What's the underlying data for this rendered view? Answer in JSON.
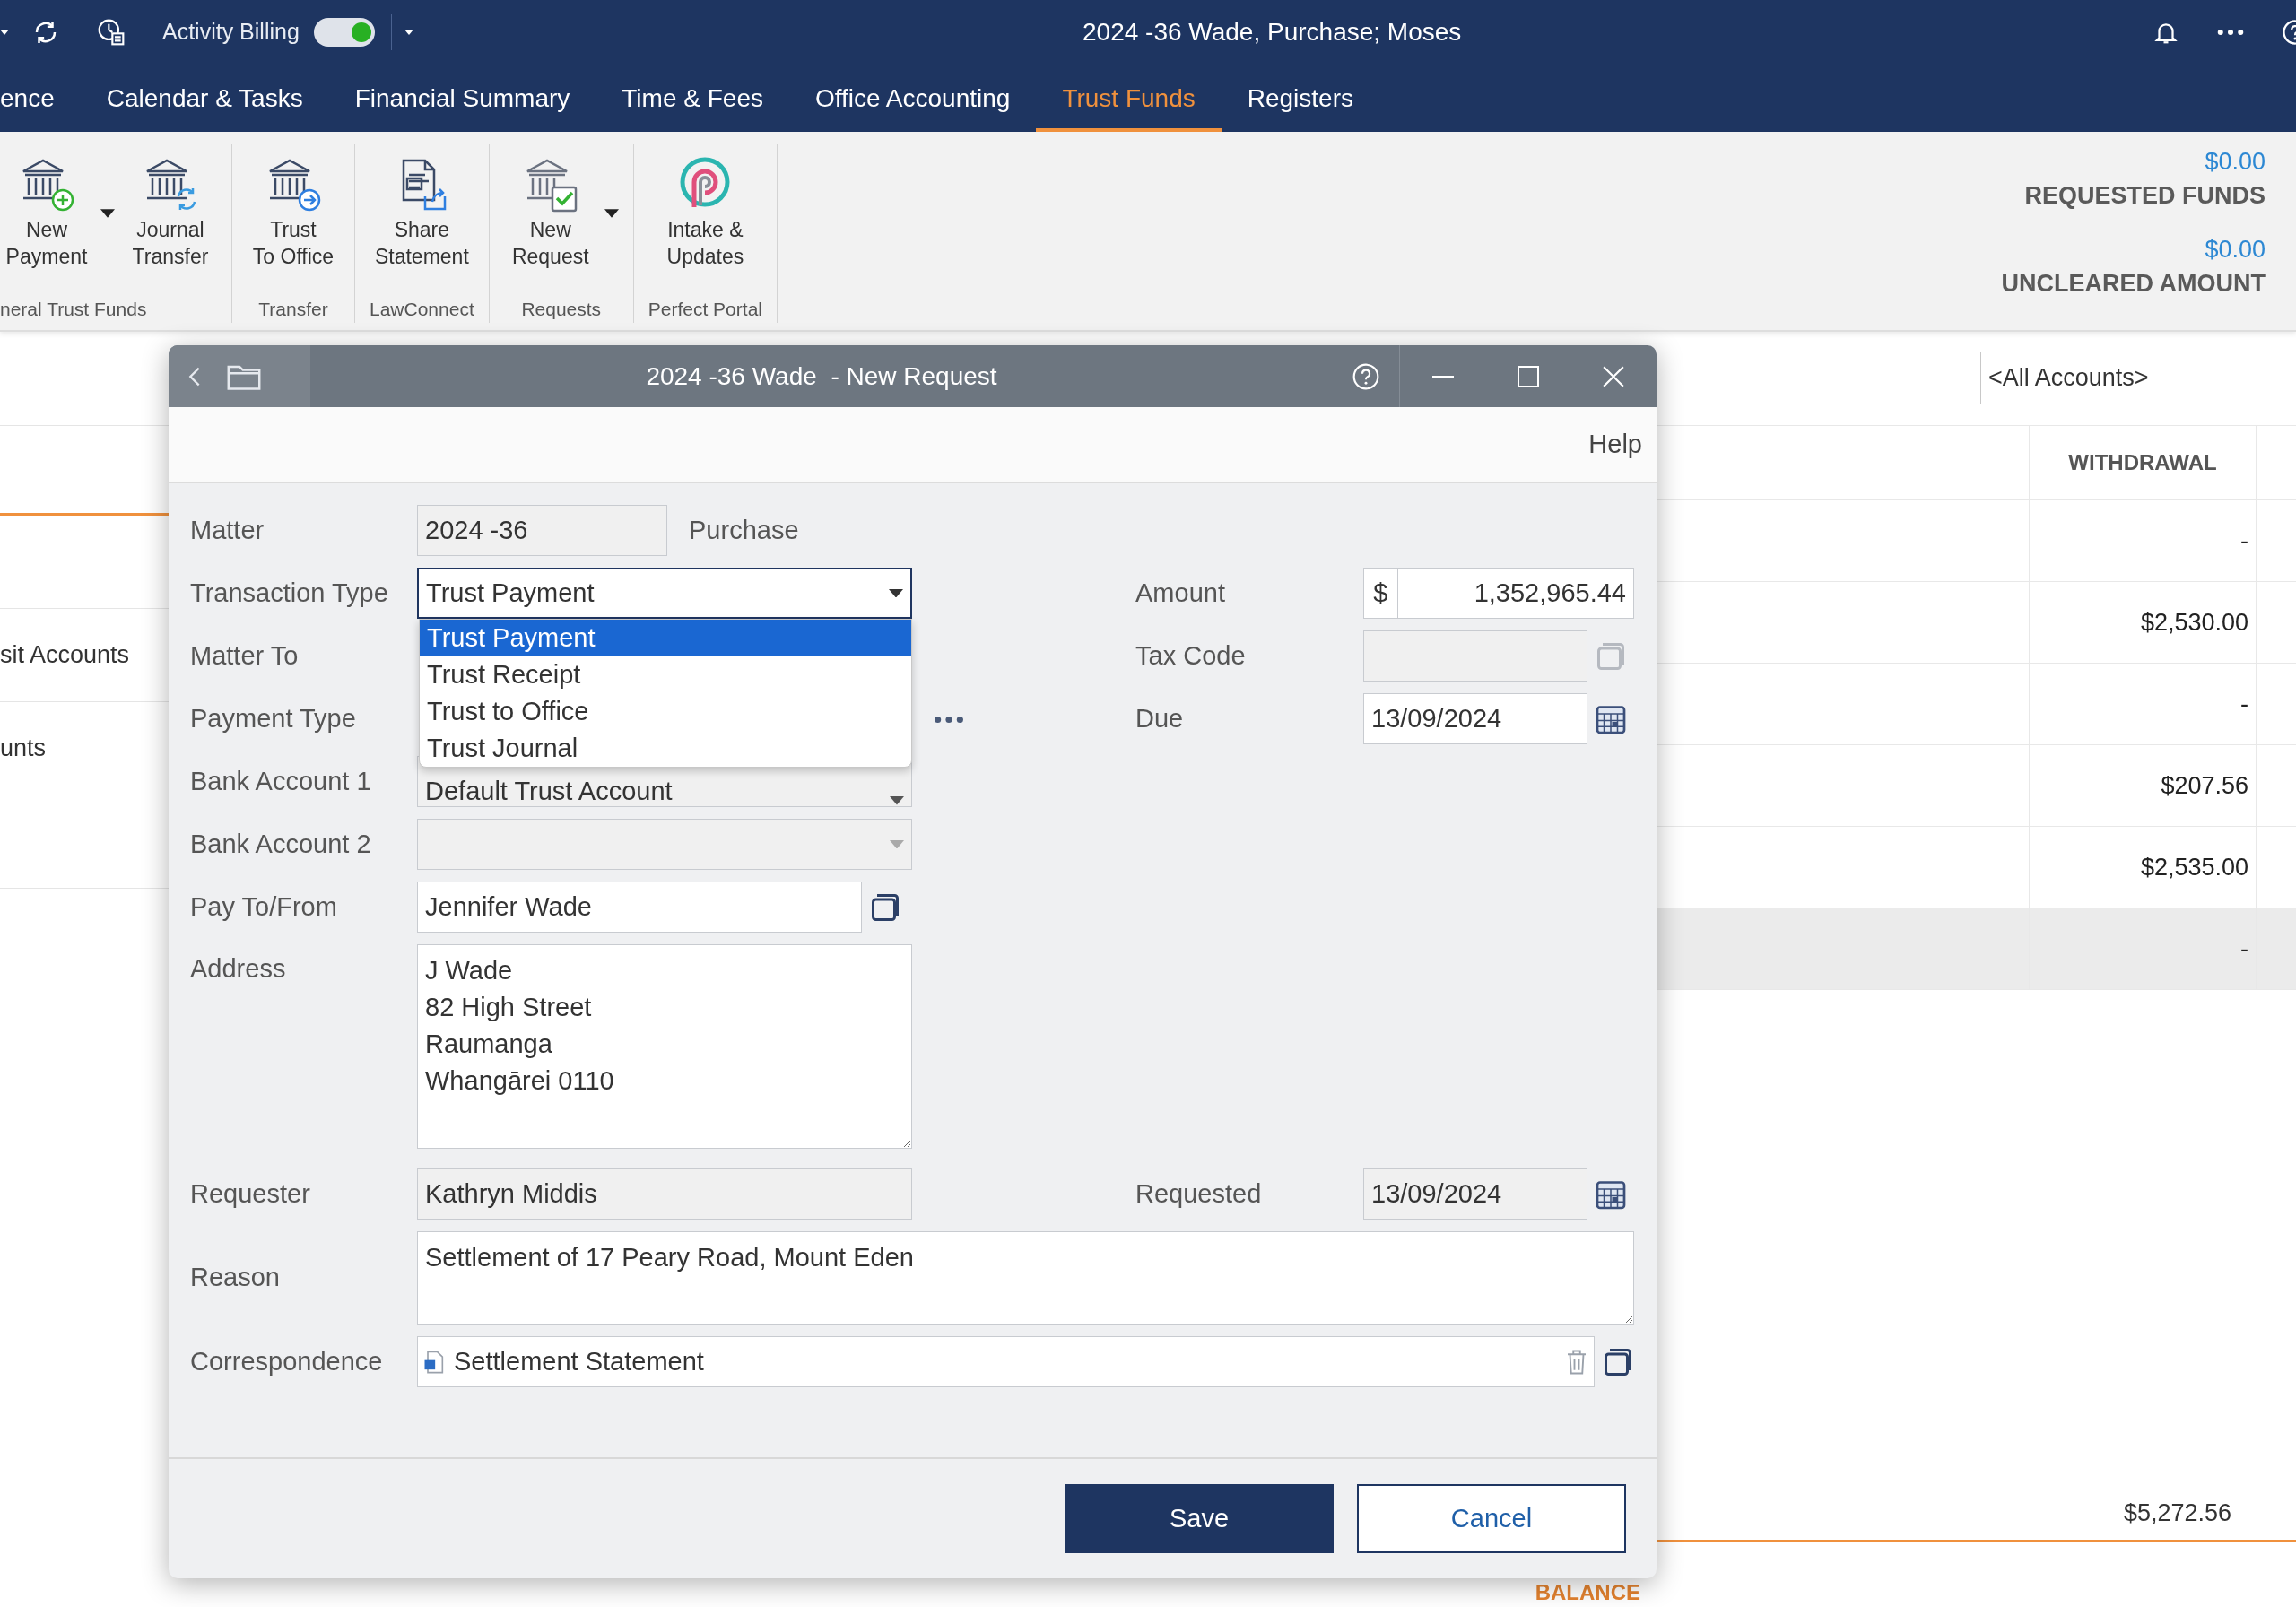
{
  "top_bar": {
    "activity_billing": {
      "label": "Activity Billing",
      "on": true
    },
    "title": "2024 -36 Wade, Purchase; Moses"
  },
  "nav_tabs": [
    {
      "label": "ence",
      "selected": false
    },
    {
      "label": "Calendar & Tasks",
      "selected": false
    },
    {
      "label": "Financial Summary",
      "selected": false
    },
    {
      "label": "Time & Fees",
      "selected": false
    },
    {
      "label": "Office Accounting",
      "selected": false
    },
    {
      "label": "Trust Funds",
      "selected": true
    },
    {
      "label": "Registers",
      "selected": false
    }
  ],
  "ribbon": {
    "groups": [
      {
        "label": "neral Trust Funds",
        "buttons": [
          {
            "lines": [
              "New",
              "Payment"
            ],
            "dropdown": true
          },
          {
            "lines": [
              "Journal",
              "Transfer"
            ],
            "dropdown": false
          }
        ]
      },
      {
        "label": "Transfer",
        "buttons": [
          {
            "lines": [
              "Trust",
              "To Office"
            ],
            "dropdown": false
          }
        ]
      },
      {
        "label": "LawConnect",
        "buttons": [
          {
            "lines": [
              "Share",
              "Statement"
            ],
            "dropdown": false
          }
        ]
      },
      {
        "label": "Requests",
        "buttons": [
          {
            "lines": [
              "New",
              "Request"
            ],
            "dropdown": true
          }
        ]
      },
      {
        "label": "Perfect Portal",
        "buttons": [
          {
            "lines": [
              "Intake &",
              "Updates"
            ],
            "dropdown": false
          }
        ]
      }
    ],
    "summary": [
      {
        "value": "$0.00",
        "label": "REQUESTED FUNDS"
      },
      {
        "value": "$0.00",
        "label": "UNCLEARED AMOUNT"
      }
    ]
  },
  "sidebar": {
    "items": [
      {
        "label": "sit Accounts"
      },
      {
        "label": "unts"
      }
    ]
  },
  "account_filter": {
    "value": "<All Accounts>"
  },
  "table": {
    "columns": [
      "WITHDRAWAL"
    ],
    "rows": [
      {
        "withdrawal": "-",
        "selected": false
      },
      {
        "withdrawal": "$2,530.00",
        "selected": false
      },
      {
        "withdrawal": "-",
        "selected": false
      },
      {
        "withdrawal": "$207.56",
        "selected": false
      },
      {
        "withdrawal": "$2,535.00",
        "selected": false
      },
      {
        "withdrawal": "-",
        "selected": true
      }
    ],
    "total": "$5,272.56",
    "footer_label": "BALANCE"
  },
  "dialog": {
    "title": "2024 -36 Wade  - New Request",
    "help": "Help",
    "matter": {
      "label": "Matter",
      "value": "2024 -36",
      "description": "Purchase",
      "disabled": true
    },
    "transaction_type": {
      "label": "Transaction Type",
      "value": "Trust Payment",
      "expanded": true,
      "options": [
        {
          "label": "Trust Payment",
          "selected": true
        },
        {
          "label": "Trust Receipt",
          "selected": false
        },
        {
          "label": "Trust to Office",
          "selected": false
        },
        {
          "label": "Trust Journal",
          "selected": false
        }
      ]
    },
    "matter_to": {
      "label": "Matter To"
    },
    "payment_type": {
      "label": "Payment Type"
    },
    "bank_account_1": {
      "label": "Bank Account 1",
      "value": "Default Trust Account",
      "disabled": true
    },
    "bank_account_2": {
      "label": "Bank Account 2",
      "disabled": true
    },
    "pay_to_from": {
      "label": "Pay To/From",
      "value": "Jennifer Wade"
    },
    "address": {
      "label": "Address",
      "value": "J Wade\n82 High Street\nRaumanga\nWhangārei 0110"
    },
    "amount": {
      "label": "Amount",
      "currency": "$",
      "value": "1,352,965.44"
    },
    "tax_code": {
      "label": "Tax Code",
      "disabled": true
    },
    "due": {
      "label": "Due",
      "value": "13/09/2024"
    },
    "requester": {
      "label": "Requester",
      "value": "Kathryn Middis",
      "disabled": true
    },
    "requested": {
      "label": "Requested",
      "value": "13/09/2024",
      "disabled": true
    },
    "reason": {
      "label": "Reason",
      "value": "Settlement of 17 Peary Road, Mount Eden"
    },
    "correspondence": {
      "label": "Correspondence",
      "value": "Settlement Statement"
    },
    "buttons": [
      {
        "label": "Save",
        "kind": "primary"
      },
      {
        "label": "Cancel",
        "kind": "secondary"
      }
    ]
  }
}
